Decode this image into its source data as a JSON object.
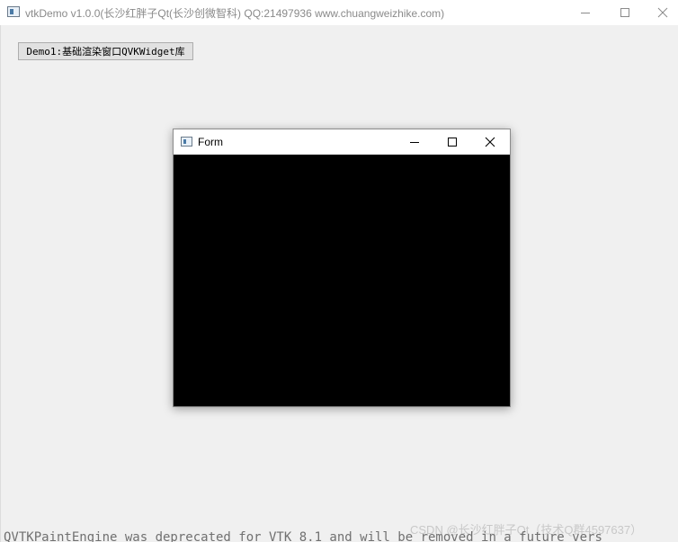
{
  "main_window": {
    "title": "vtkDemo v1.0.0(长沙红胖子Qt(长沙创微智科) QQ:21497936 www.chuangweizhike.com)",
    "icon": "app-window-icon",
    "controls": [
      "minimize-icon",
      "maximize-icon",
      "close-icon"
    ]
  },
  "toolbar": {
    "demo_button_label": "Demo1:基础渲染窗口QVKWidget库"
  },
  "form_window": {
    "title": "Form",
    "icon": "app-window-icon",
    "controls": [
      "minimize-icon",
      "maximize-icon",
      "close-icon"
    ],
    "render_background": "#000000"
  },
  "console": {
    "text": "QVTKPaintEngine was deprecated for VTK 8.1 and will be removed in a future vers"
  },
  "watermark": {
    "text": "CSDN @长沙红胖子Qt（技术Q群4597637）"
  }
}
